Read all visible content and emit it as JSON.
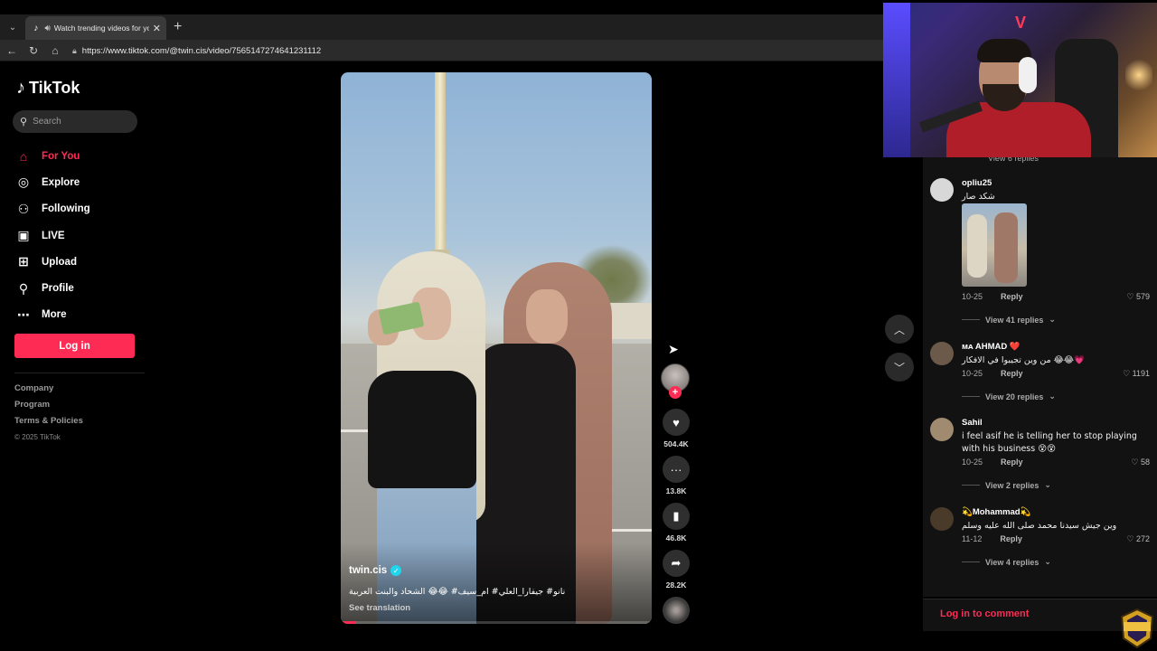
{
  "browser": {
    "tab_title": "Watch trending videos for you | TikTok",
    "url": "https://www.tiktok.com/@twin.cis/video/7565147274641231112"
  },
  "sidebar": {
    "logo": "TikTok",
    "search_placeholder": "Search",
    "nav": [
      {
        "label": "For You",
        "icon": "home-icon",
        "active": true
      },
      {
        "label": "Explore",
        "icon": "compass-icon",
        "active": false
      },
      {
        "label": "Following",
        "icon": "following-icon",
        "active": false
      },
      {
        "label": "LIVE",
        "icon": "live-icon",
        "active": false
      },
      {
        "label": "Upload",
        "icon": "upload-icon",
        "active": false
      },
      {
        "label": "Profile",
        "icon": "profile-icon",
        "active": false
      },
      {
        "label": "More",
        "icon": "more-icon",
        "active": false
      }
    ],
    "login_label": "Log in",
    "footer": {
      "company": "Company",
      "program": "Program",
      "terms": "Terms & Policies",
      "copyright": "© 2025 TikTok"
    }
  },
  "video": {
    "author": "twin.cis",
    "caption": "نانو# جيفارا_العلي# ام_سيف# 😂😂 الشحاد والبنت العربية",
    "see_translation": "See translation",
    "progress": 0.05,
    "likes": "504.4K",
    "comments": "13.8K",
    "saves": "46.8K",
    "shares": "28.2K"
  },
  "comments": {
    "top_replies": "View 6 replies",
    "items": [
      {
        "user": "opliu25",
        "text": "شكد صار",
        "date": "10-25",
        "likes": "579",
        "view_replies": "View 41 replies",
        "has_image": true
      },
      {
        "user": "ᴍᴀ AHMAD ❤️",
        "text": "من وين تجيبوا في الافكار 😂😂💗",
        "date": "10-25",
        "likes": "1191",
        "view_replies": "View 20 replies"
      },
      {
        "user": "Sahil",
        "text": "i feel asif he is telling her to stop playing with his business 😵😵",
        "date": "10-25",
        "likes": "58",
        "view_replies": "View 2 replies"
      },
      {
        "user": "💫Mohammad💫",
        "text": "وين جيش سيدنا محمد صلى الله عليه وسلم",
        "date": "11-12",
        "likes": "272",
        "view_replies": "View 4 replies"
      }
    ],
    "reply_label": "Reply",
    "login_to_comment": "Log in to comment"
  },
  "colors": {
    "accent": "#fe2c55",
    "background": "#000000",
    "panel": "#121212"
  }
}
